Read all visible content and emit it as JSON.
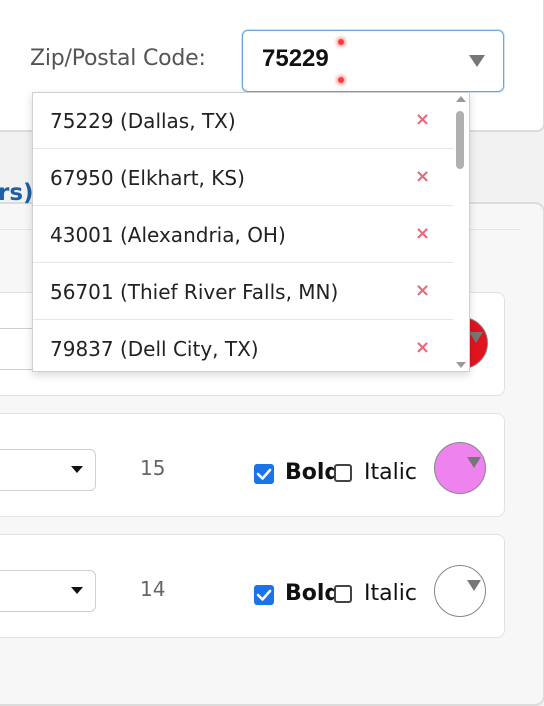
{
  "zip": {
    "label": "Zip/Postal Code:",
    "value": "75229"
  },
  "section": {
    "title_fragment": "rs)"
  },
  "dropdown": {
    "items": [
      {
        "label": "75229 (Dallas, TX)",
        "remove": "×"
      },
      {
        "label": "67950 (Elkhart, KS)",
        "remove": "×"
      },
      {
        "label": "43001 (Alexandria, OH)",
        "remove": "×"
      },
      {
        "label": "56701 (Thief River Falls, MN)",
        "remove": "×"
      },
      {
        "label": "79837 (Dell City, TX)",
        "remove": "×"
      }
    ],
    "scroll_position": 0
  },
  "rows": [
    {
      "size": "15",
      "bold_label": "Bold",
      "bold_checked": true,
      "italic_label": "Italic",
      "italic_checked": false,
      "color": "#ee82ee"
    },
    {
      "size": "14",
      "bold_label": "Bold",
      "bold_checked": true,
      "italic_label": "Italic",
      "italic_checked": false,
      "color": "#ffffff"
    }
  ],
  "hidden_row": {
    "color": "#e0141e"
  },
  "colors": {
    "accent": "#1a73e8",
    "section_title": "#1e5fa8",
    "remove_x": "#e46b7a"
  }
}
